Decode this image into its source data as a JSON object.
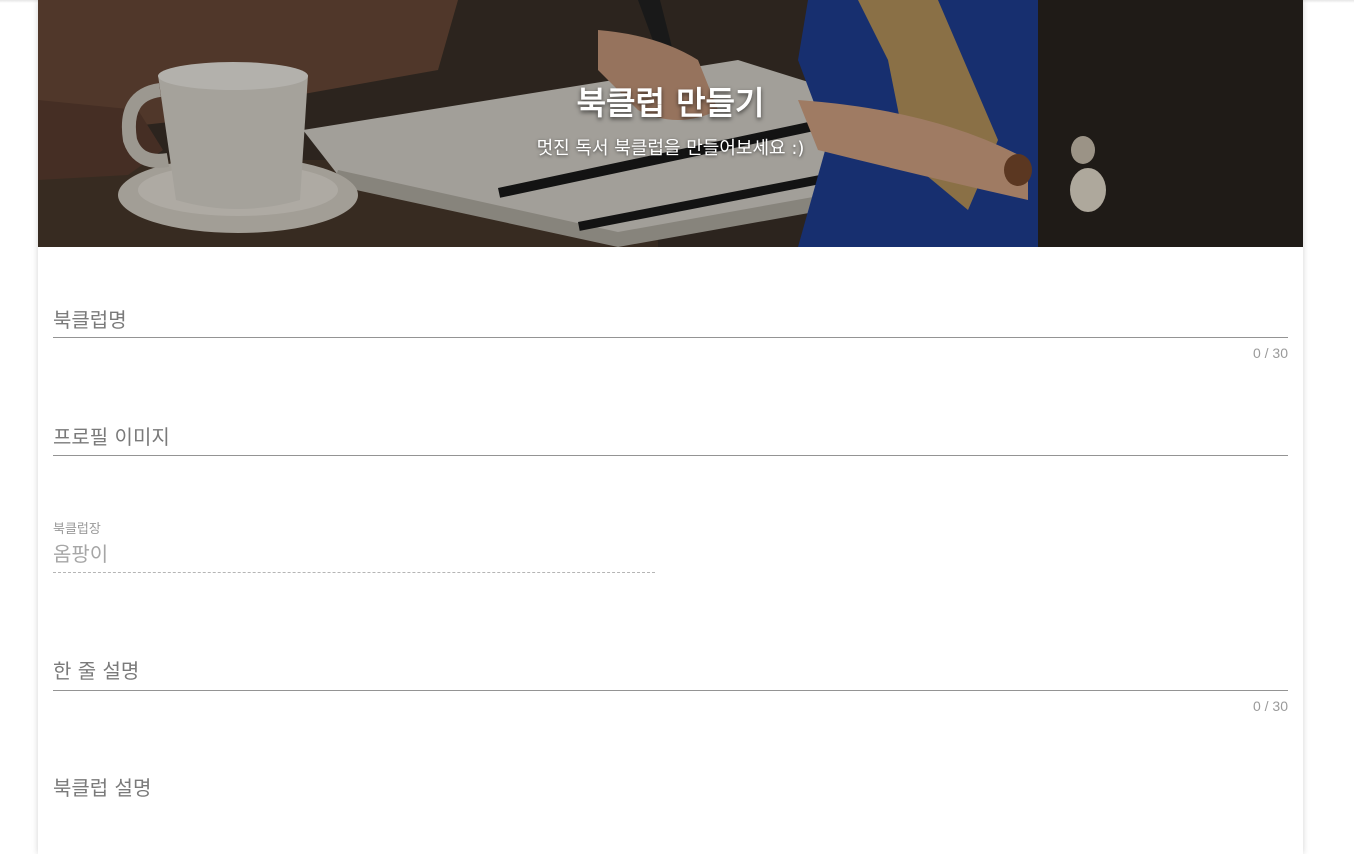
{
  "header": {
    "title": "북클럽 만들기",
    "subtitle": "멋진 독서 북클럽을 만들어보세요 :)"
  },
  "form": {
    "club_name": {
      "label": "북클럽명",
      "counter": "0 / 30"
    },
    "profile_image": {
      "label": "프로필 이미지"
    },
    "club_leader": {
      "label": "북클럽장",
      "value": "옴팡이"
    },
    "short_description": {
      "label": "한 줄 설명",
      "counter": "0 / 30"
    },
    "club_description": {
      "label": "북클럽 설명"
    }
  }
}
